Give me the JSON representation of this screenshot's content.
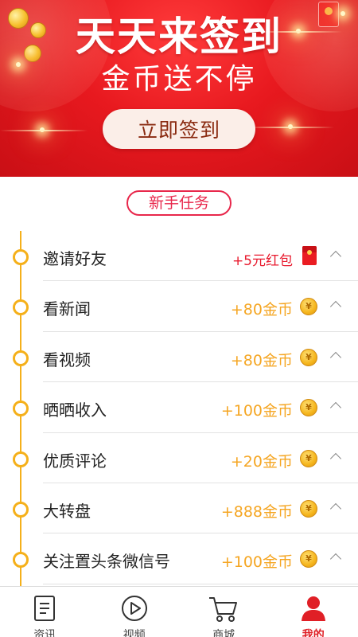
{
  "banner": {
    "title": "天天来签到",
    "subtitle": "金币送不停",
    "checkin_button": "立即签到"
  },
  "section": {
    "label": "新手任务"
  },
  "tasks": [
    {
      "name": "邀请好友",
      "reward": "+5元红包",
      "icon": "red-envelope-icon"
    },
    {
      "name": "看新闻",
      "reward": "+80金币",
      "icon": "coin-icon"
    },
    {
      "name": "看视频",
      "reward": "+80金币",
      "icon": "coin-icon"
    },
    {
      "name": "晒晒收入",
      "reward": "+100金币",
      "icon": "coin-icon"
    },
    {
      "name": "优质评论",
      "reward": "+20金币",
      "icon": "coin-icon"
    },
    {
      "name": "大转盘",
      "reward": "+888金币",
      "icon": "coin-icon"
    },
    {
      "name": "关注置头条微信号",
      "reward": "+100金币",
      "icon": "coin-icon"
    }
  ],
  "coin_symbol": "¥",
  "nav": {
    "items": [
      {
        "label": "资讯",
        "icon": "news-icon",
        "active": false
      },
      {
        "label": "视频",
        "icon": "play-icon",
        "active": false
      },
      {
        "label": "商城",
        "icon": "cart-icon",
        "active": false
      },
      {
        "label": "我的",
        "icon": "user-icon",
        "active": true
      }
    ]
  },
  "colors": {
    "banner_red": "#e8191f",
    "accent_red": "#e8274b",
    "reward_gold": "#f5a623",
    "timeline_gold": "#f5b01a",
    "nav_active": "#e01f26"
  }
}
